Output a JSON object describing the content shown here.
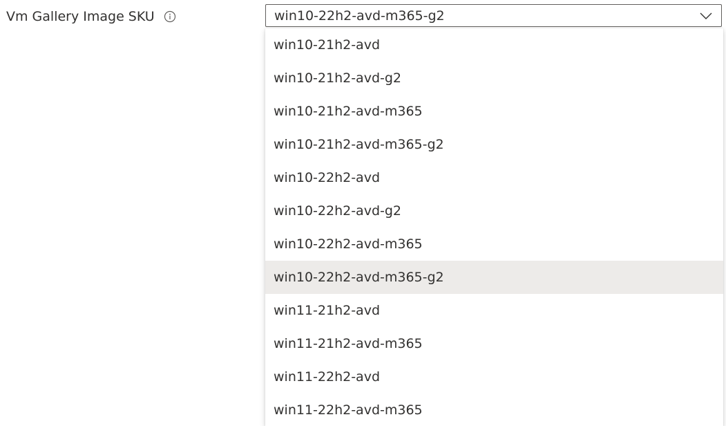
{
  "field": {
    "label": "Vm Gallery Image SKU",
    "info_icon": "info-icon"
  },
  "dropdown": {
    "selected_value": "win10-22h2-avd-m365-g2",
    "chevron_icon": "chevron-down-icon",
    "options": [
      "win10-21h2-avd",
      "win10-21h2-avd-g2",
      "win10-21h2-avd-m365",
      "win10-21h2-avd-m365-g2",
      "win10-22h2-avd",
      "win10-22h2-avd-g2",
      "win10-22h2-avd-m365",
      "win10-22h2-avd-m365-g2",
      "win11-21h2-avd",
      "win11-21h2-avd-m365",
      "win11-22h2-avd",
      "win11-22h2-avd-m365"
    ],
    "selected_index": 7
  },
  "colors": {
    "text": "#323130",
    "border": "#605e5c",
    "selected_background": "#edebe9"
  }
}
